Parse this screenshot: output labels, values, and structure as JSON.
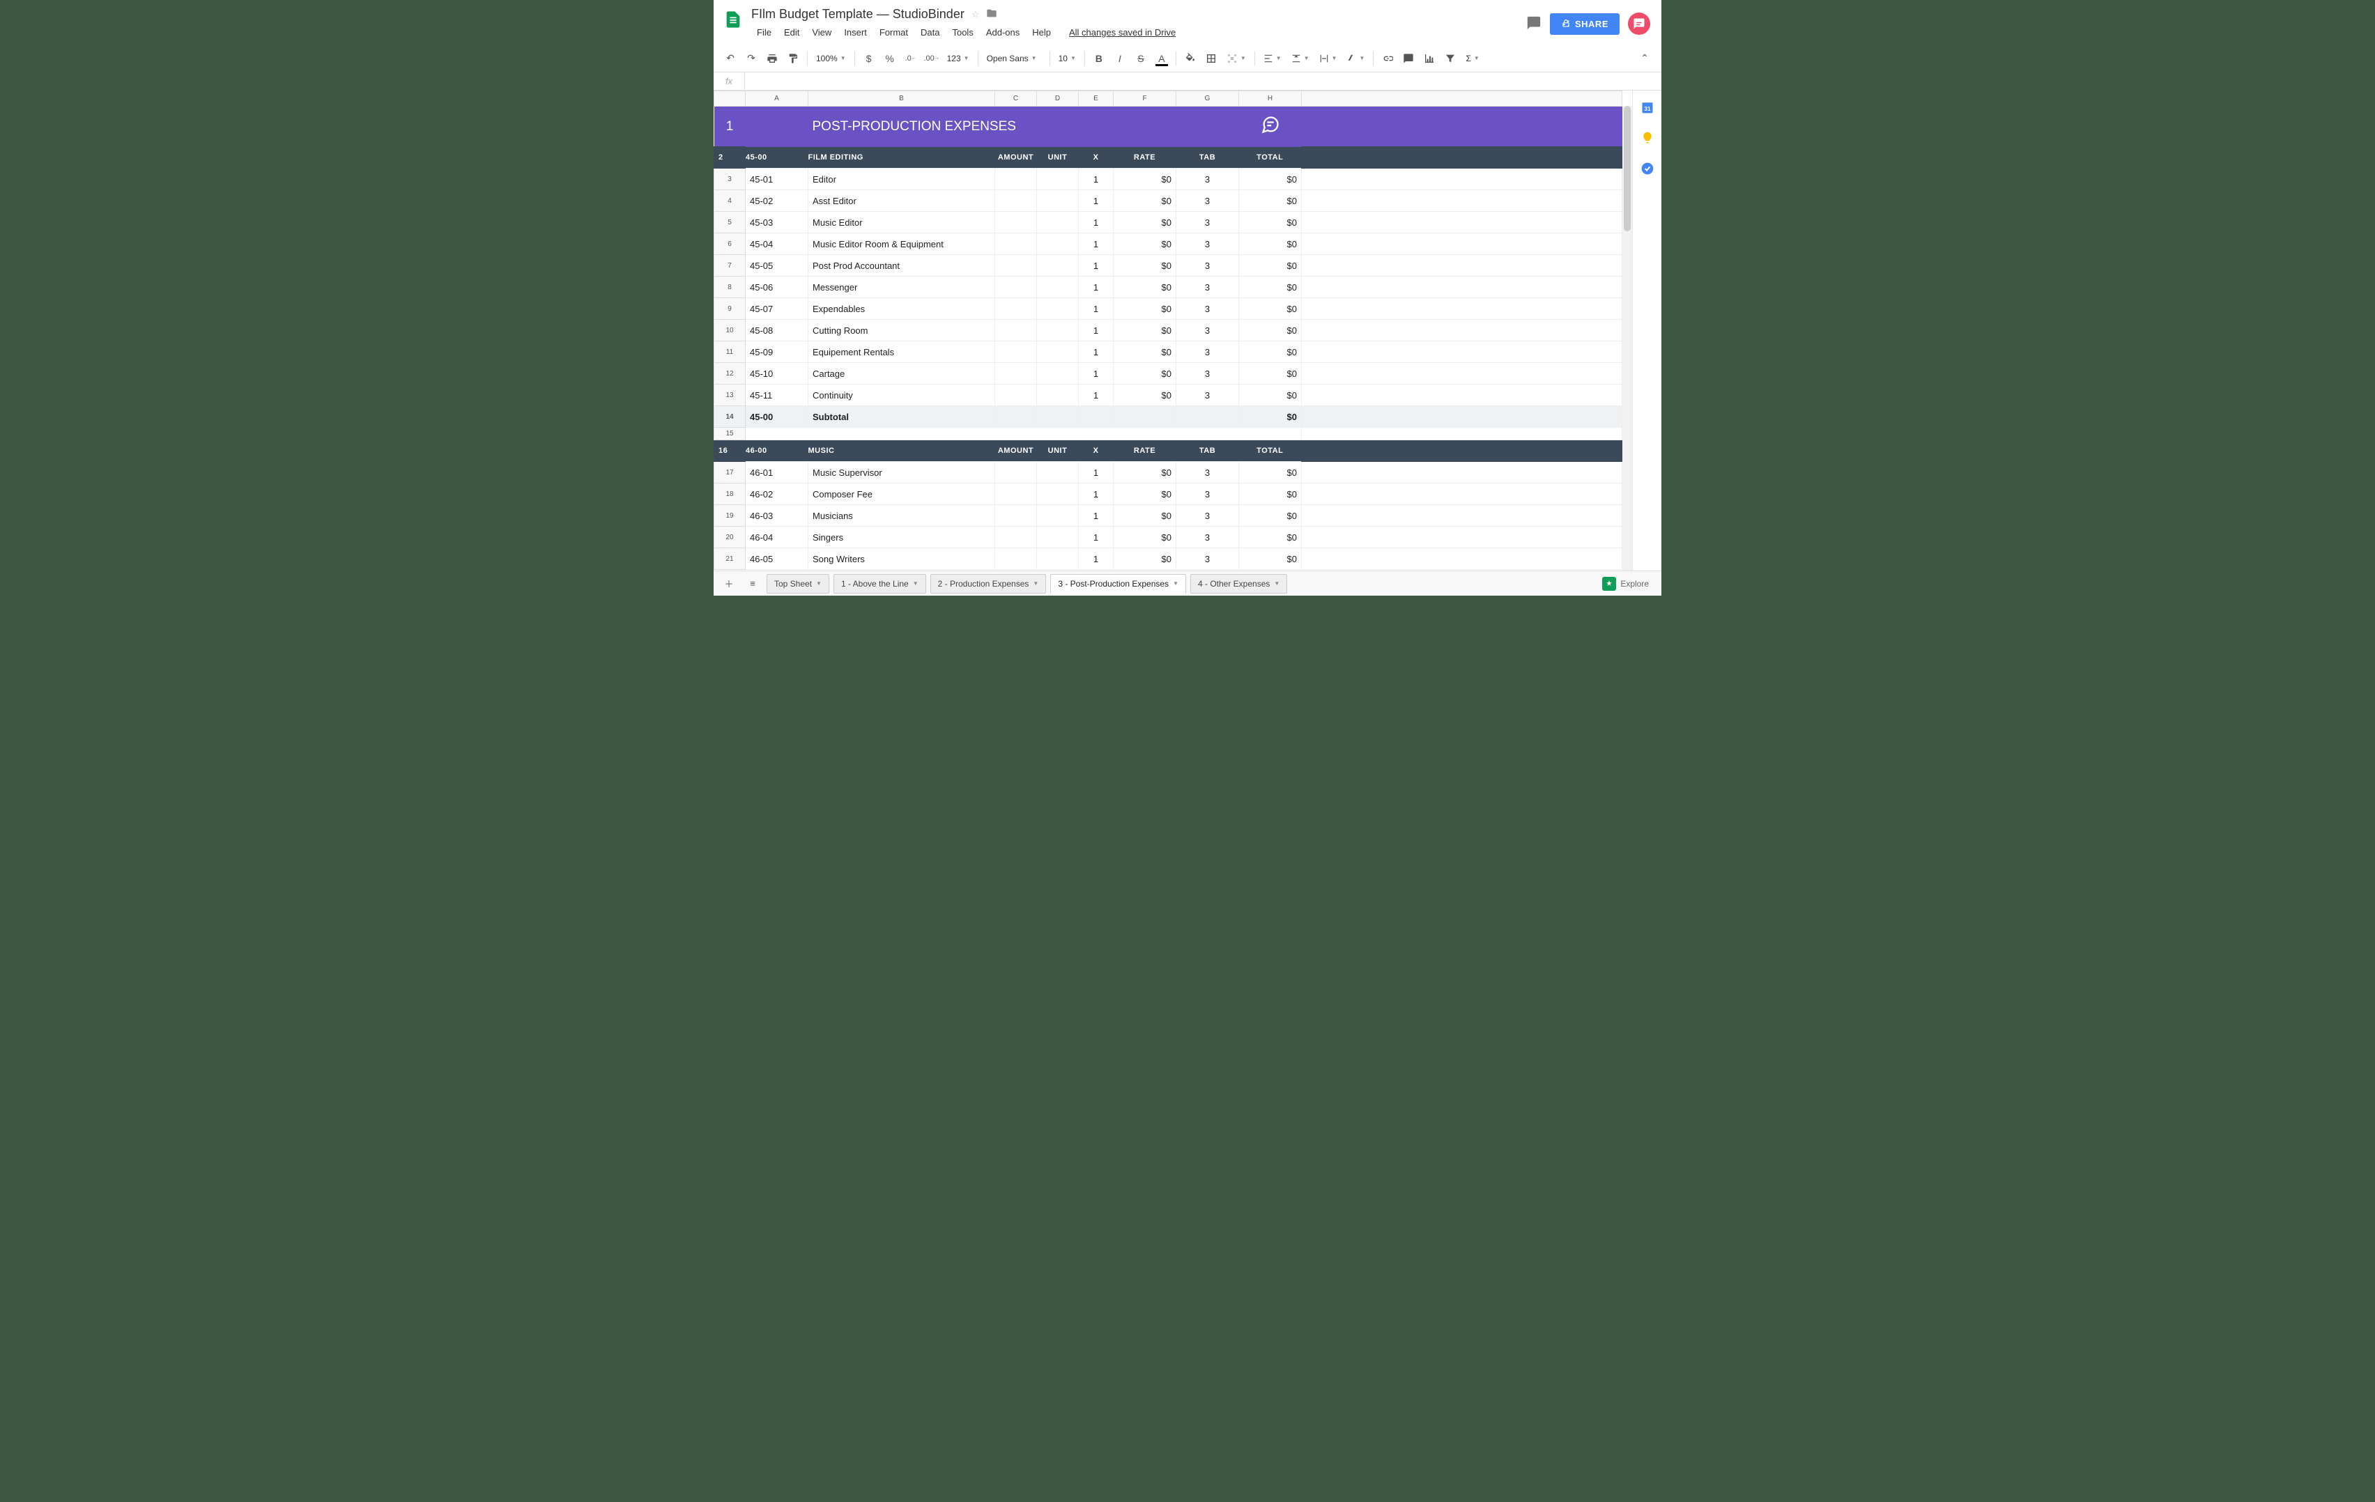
{
  "doc_title": "FIlm Budget Template — StudioBinder",
  "menubar": [
    "File",
    "Edit",
    "View",
    "Insert",
    "Format",
    "Data",
    "Tools",
    "Add-ons",
    "Help"
  ],
  "save_status": "All changes saved in Drive",
  "share_label": "SHARE",
  "toolbar": {
    "zoom": "100%",
    "font": "Open Sans",
    "size": "10"
  },
  "columns": [
    "A",
    "B",
    "C",
    "D",
    "E",
    "F",
    "G",
    "H"
  ],
  "selected_col": "D",
  "title_row": {
    "text": "POST-PRODUCTION EXPENSES"
  },
  "section_header": {
    "code_col": "",
    "cols": [
      "AMOUNT",
      "UNIT",
      "X",
      "RATE",
      "TAB",
      "TOTAL"
    ]
  },
  "sections": [
    {
      "code": "45-00",
      "name": "FILM EDITING",
      "rows": [
        {
          "n": 3,
          "code": "45-01",
          "desc": "Editor",
          "x": "1",
          "rate": "$0",
          "tab": "3",
          "total": "$0"
        },
        {
          "n": 4,
          "code": "45-02",
          "desc": "Asst Editor",
          "x": "1",
          "rate": "$0",
          "tab": "3",
          "total": "$0"
        },
        {
          "n": 5,
          "code": "45-03",
          "desc": "Music Editor",
          "x": "1",
          "rate": "$0",
          "tab": "3",
          "total": "$0"
        },
        {
          "n": 6,
          "code": "45-04",
          "desc": "Music Editor Room & Equipment",
          "x": "1",
          "rate": "$0",
          "tab": "3",
          "total": "$0"
        },
        {
          "n": 7,
          "code": "45-05",
          "desc": "Post Prod Accountant",
          "x": "1",
          "rate": "$0",
          "tab": "3",
          "total": "$0"
        },
        {
          "n": 8,
          "code": "45-06",
          "desc": "Messenger",
          "x": "1",
          "rate": "$0",
          "tab": "3",
          "total": "$0"
        },
        {
          "n": 9,
          "code": "45-07",
          "desc": "Expendables",
          "x": "1",
          "rate": "$0",
          "tab": "3",
          "total": "$0"
        },
        {
          "n": 10,
          "code": "45-08",
          "desc": "Cutting Room",
          "x": "1",
          "rate": "$0",
          "tab": "3",
          "total": "$0"
        },
        {
          "n": 11,
          "code": "45-09",
          "desc": "Equipement Rentals",
          "x": "1",
          "rate": "$0",
          "tab": "3",
          "total": "$0"
        },
        {
          "n": 12,
          "code": "45-10",
          "desc": "Cartage",
          "x": "1",
          "rate": "$0",
          "tab": "3",
          "total": "$0"
        },
        {
          "n": 13,
          "code": "45-11",
          "desc": "Continuity",
          "x": "1",
          "rate": "$0",
          "tab": "3",
          "total": "$0"
        }
      ],
      "subtotal": {
        "n": 14,
        "code": "45-00",
        "desc": "Subtotal",
        "total": "$0"
      }
    },
    {
      "code": "46-00",
      "name": "MUSIC",
      "rows": [
        {
          "n": 17,
          "code": "46-01",
          "desc": "Music Supervisor",
          "x": "1",
          "rate": "$0",
          "tab": "3",
          "total": "$0"
        },
        {
          "n": 18,
          "code": "46-02",
          "desc": "Composer Fee",
          "x": "1",
          "rate": "$0",
          "tab": "3",
          "total": "$0"
        },
        {
          "n": 19,
          "code": "46-03",
          "desc": "Musicians",
          "x": "1",
          "rate": "$0",
          "tab": "3",
          "total": "$0"
        },
        {
          "n": 20,
          "code": "46-04",
          "desc": "Singers",
          "x": "1",
          "rate": "$0",
          "tab": "3",
          "total": "$0"
        },
        {
          "n": 21,
          "code": "46-05",
          "desc": "Song Writers",
          "x": "1",
          "rate": "$0",
          "tab": "3",
          "total": "$0"
        }
      ]
    }
  ],
  "tabs": [
    "Top Sheet",
    "1 - Above the Line",
    "2 - Production Expenses",
    "3 - Post-Production Expenses",
    "4 - Other Expenses"
  ],
  "active_tab": 3,
  "explore_label": "Explore"
}
